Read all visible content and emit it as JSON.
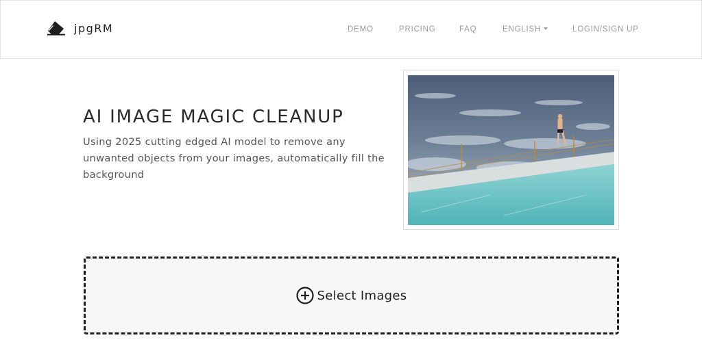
{
  "brand": {
    "name": "jpgRM",
    "icon": "eraser-icon"
  },
  "nav": {
    "items": [
      {
        "label": "DEMO"
      },
      {
        "label": "PRICING"
      },
      {
        "label": "FAQ"
      },
      {
        "label": "ENGLISH",
        "dropdown": true
      },
      {
        "label": "LOGIN/SIGN UP"
      }
    ]
  },
  "hero": {
    "title": "AI IMAGE MAGIC CLEANUP",
    "description": "Using 2025 cutting edged AI model to remove any unwanted objects from your images, automatically fill the background",
    "image": "ocean-pool-photo"
  },
  "upload": {
    "label": "Select Images",
    "icon": "plus-circle-icon"
  },
  "colors": {
    "nav_text": "#9a9a9a",
    "title_text": "#2a2a2a",
    "dropzone_border": "#1e1e1e",
    "dropzone_bg": "#f7f7f7"
  }
}
